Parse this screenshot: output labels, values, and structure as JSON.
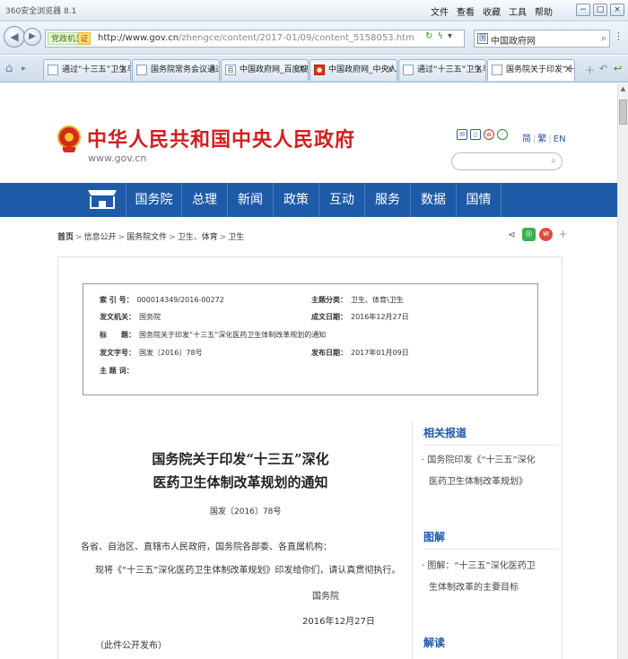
{
  "browser": {
    "app_title": "360安全浏览器 8.1",
    "menu": [
      "文件",
      "查看",
      "收藏",
      "工具",
      "帮助"
    ],
    "window_buttons": [
      "−",
      "□",
      "×"
    ],
    "address": {
      "safe_label": "党政机关",
      "cert_label": "证",
      "url_host": "http://www.gov.cn",
      "url_path": "/zhengce/content/2017-01/09/content_5158053.htm"
    },
    "search_engine": "中国政府网",
    "tabs": [
      {
        "label": "通过“十三五”卫生与",
        "active": false
      },
      {
        "label": "国务院常务会议通过“",
        "active": false
      },
      {
        "label": "中国政府网_百度搜索",
        "active": false
      },
      {
        "label": "中国政府网_中央人民",
        "active": false
      },
      {
        "label": "通过“十三五”卫生与",
        "active": false
      },
      {
        "label": "国务院关于印发“十三",
        "active": true
      }
    ]
  },
  "site": {
    "title": "中华人民共和国中央人民政府",
    "url": "www.gov.cn",
    "lang": {
      "simplified": "简",
      "traditional": "繁",
      "english": "EN"
    },
    "nav": [
      "国务院",
      "总理",
      "新闻",
      "政策",
      "互动",
      "服务",
      "数据",
      "国情"
    ]
  },
  "breadcrumb": [
    "首页",
    "信息公开",
    "国务院文件",
    "卫生、体育",
    "卫生"
  ],
  "info": {
    "index_no_k": "索 引 号：",
    "index_no_v": "000014349/2016-00272",
    "category_k": "主题分类：",
    "category_v": "卫生、体育\\卫生",
    "issuer_k": "发文机关：",
    "issuer_v": "国务院",
    "written_k": "成文日期：",
    "written_v": "2016年12月27日",
    "title_k": "标　　题：",
    "title_v": "国务院关于印发“十三五”深化医药卫生体制改革规划的通知",
    "doc_no_k": "发文字号：",
    "doc_no_v": "国发〔2016〕78号",
    "published_k": "发布日期：",
    "published_v": "2017年01月09日",
    "keywords_k": "主 题 词：",
    "keywords_v": ""
  },
  "article": {
    "title_line1": "国务院关于印发“十三五”深化",
    "title_line2": "医药卫生体制改革规划的通知",
    "doc_no": "国发〔2016〕78号",
    "salutation": "各省、自治区、直辖市人民政府，国务院各部委、各直属机构：",
    "body": "现将《“十三五”深化医药卫生体制改革规划》印发给你们，请认真贯彻执行。",
    "signer": "国务院",
    "date": "2016年12月27日",
    "note": "（此件公开发布）"
  },
  "sidebar": {
    "related_title": "相关报道",
    "related_item_l1": "· 国务院印发《“十三五”深化",
    "related_item_l2": "医药卫生体制改革规划》",
    "graphic_title": "图解",
    "graphic_item_l1": "· 图解：“十三五”深化医药卫",
    "graphic_item_l2": "生体制改革的主要目标",
    "interpret_title": "解读"
  }
}
